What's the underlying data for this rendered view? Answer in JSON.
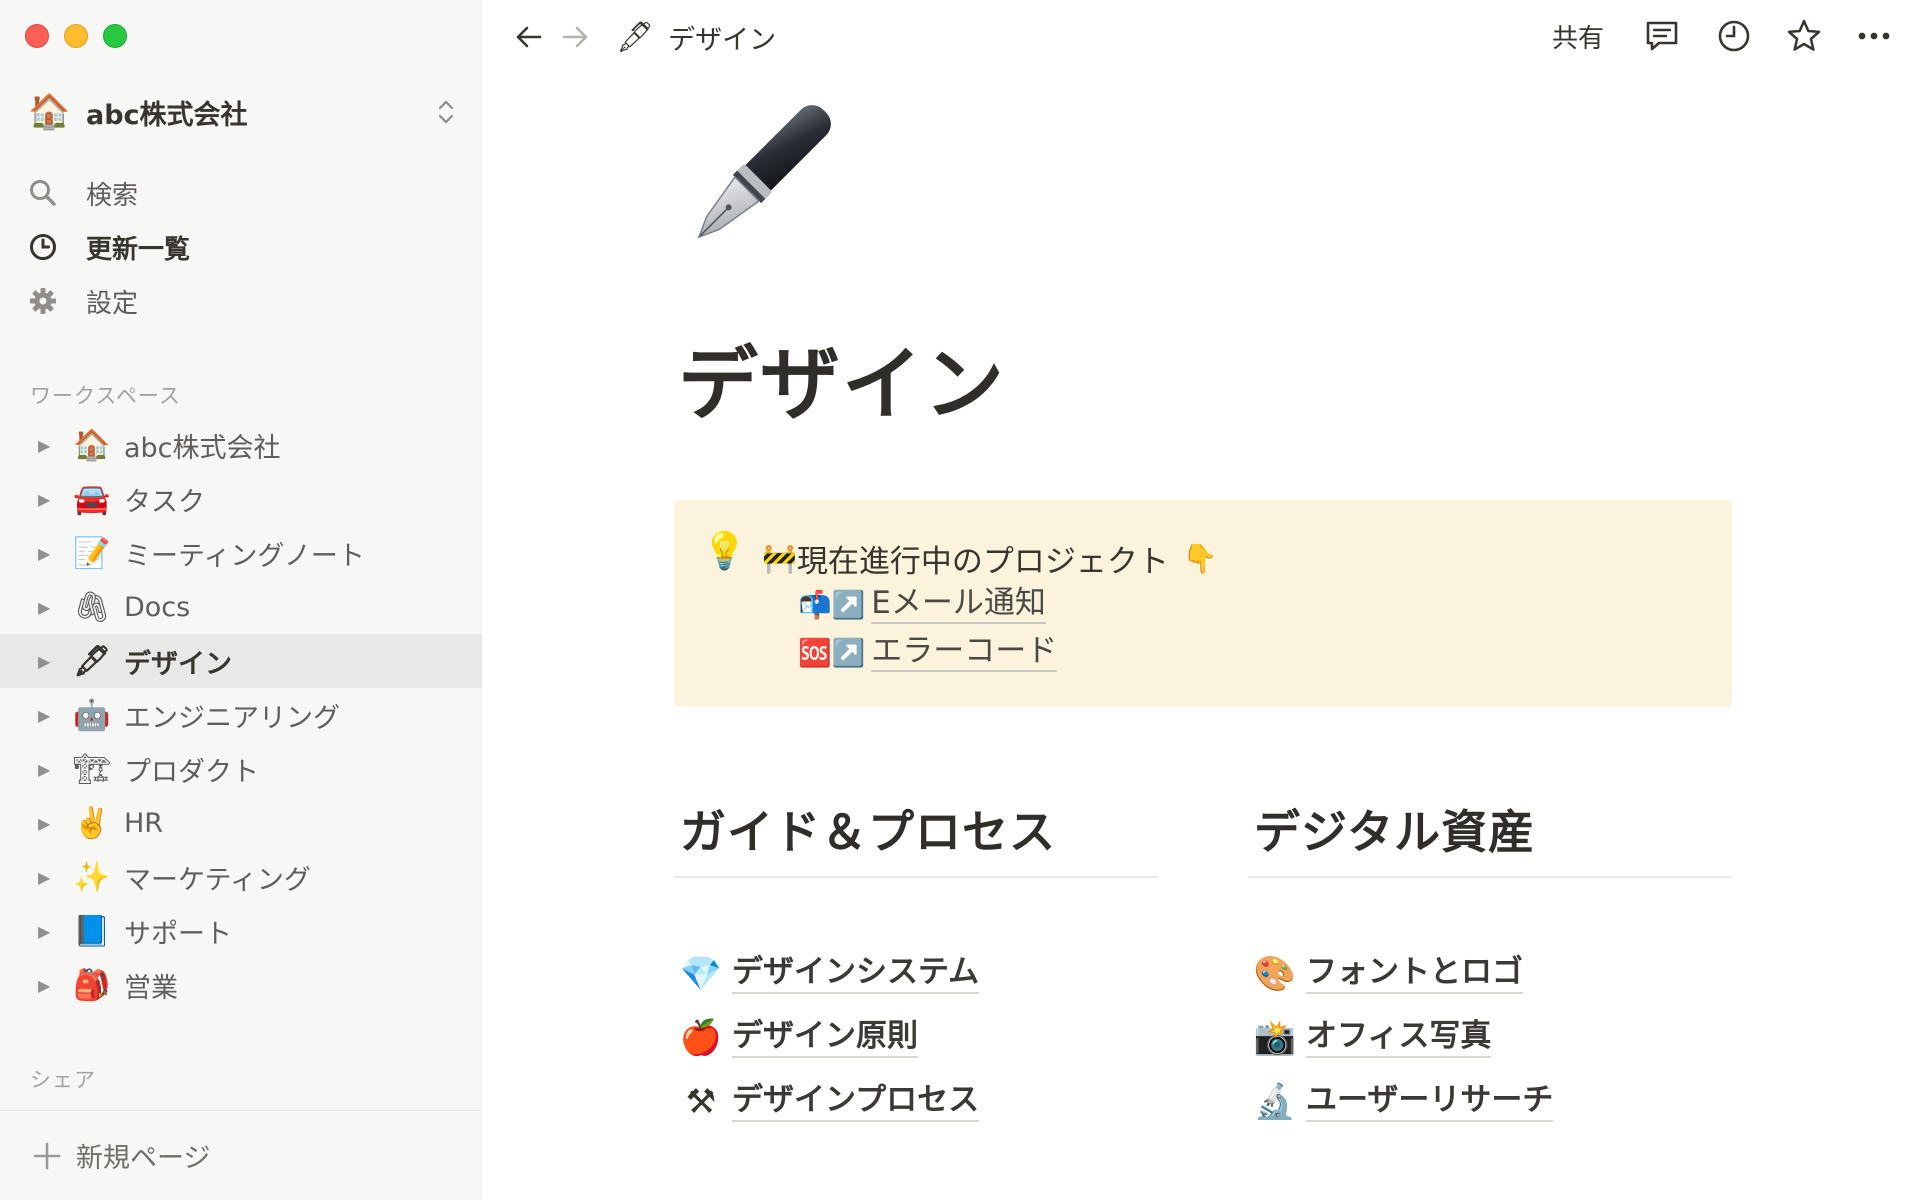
{
  "sidebar": {
    "workspace": {
      "emoji": "🏠",
      "name": "abc株式会社"
    },
    "nav": [
      {
        "icon": "search-icon",
        "label": "検索"
      },
      {
        "icon": "clock-icon",
        "label": "更新一覧"
      },
      {
        "icon": "gear-icon",
        "label": "設定"
      }
    ],
    "workspace_section_label": "ワークスペース",
    "tree": [
      {
        "emoji": "🏠",
        "label": "abc株式会社"
      },
      {
        "emoji": "🚘",
        "label": "タスク"
      },
      {
        "emoji": "📝",
        "label": "ミーティングノート"
      },
      {
        "emoji": "🖇",
        "label": "Docs"
      },
      {
        "emoji": "🖋",
        "label": "デザイン",
        "active": true
      },
      {
        "emoji": "🤖",
        "label": "エンジニアリング"
      },
      {
        "emoji": "🏗",
        "label": "プロダクト"
      },
      {
        "emoji": "✌️",
        "label": "HR"
      },
      {
        "emoji": "✨",
        "label": "マーケティング"
      },
      {
        "emoji": "📘",
        "label": "サポート"
      },
      {
        "emoji": "🎒",
        "label": "営業"
      }
    ],
    "shared_section_label": "シェア",
    "new_page_label": "新規ページ"
  },
  "topbar": {
    "breadcrumb_emoji": "🖋",
    "breadcrumb_title": "デザイン",
    "share_label": "共有"
  },
  "page": {
    "title": "デザイン",
    "callout": {
      "icon": "💡",
      "heading_prefix": "🚧",
      "heading": "現在進行中のプロジェクト",
      "heading_suffix": "👇",
      "links": [
        {
          "emoji": "📬↗️",
          "label": "Eメール通知"
        },
        {
          "emoji": "🆘↗️",
          "label": "エラーコード"
        }
      ]
    },
    "columns": [
      {
        "heading": "ガイド＆プロセス",
        "links": [
          {
            "emoji": "💎",
            "label": "デザインシステム"
          },
          {
            "emoji": "🍎",
            "label": "デザイン原則"
          },
          {
            "emoji": "⚒",
            "label": "デザインプロセス"
          }
        ]
      },
      {
        "heading": "デジタル資産",
        "links": [
          {
            "emoji": "🎨",
            "label": "フォントとロゴ"
          },
          {
            "emoji": "📸",
            "label": "オフィス写真"
          },
          {
            "emoji": "🔬",
            "label": "ユーザーリサーチ"
          }
        ]
      }
    ]
  }
}
